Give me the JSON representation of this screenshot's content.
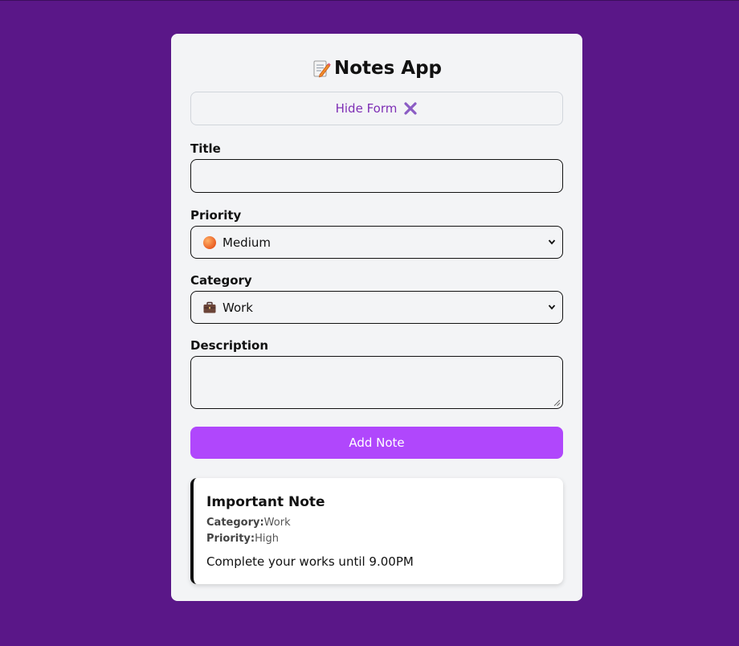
{
  "app": {
    "title": "Notes App",
    "title_icon": "memo-icon"
  },
  "toggle": {
    "label": "Hide Form",
    "icon": "close-x-icon"
  },
  "form": {
    "title_label": "Title",
    "title_value": "",
    "priority_label": "Priority",
    "priority_value": "Medium",
    "priority_icon": "orange-circle-icon",
    "category_label": "Category",
    "category_value": "Work",
    "category_icon": "briefcase-icon",
    "description_label": "Description",
    "description_value": "",
    "submit_label": "Add Note"
  },
  "notes": [
    {
      "title": "Important Note",
      "category_label": "Category:",
      "category": "Work",
      "priority_label": "Priority:",
      "priority": "High",
      "description": "Complete your works until 9.00PM"
    }
  ],
  "colors": {
    "background": "#5a1788",
    "card": "#f3f4f6",
    "accent": "#b047fc",
    "toggle_text": "#7e2fb5"
  }
}
